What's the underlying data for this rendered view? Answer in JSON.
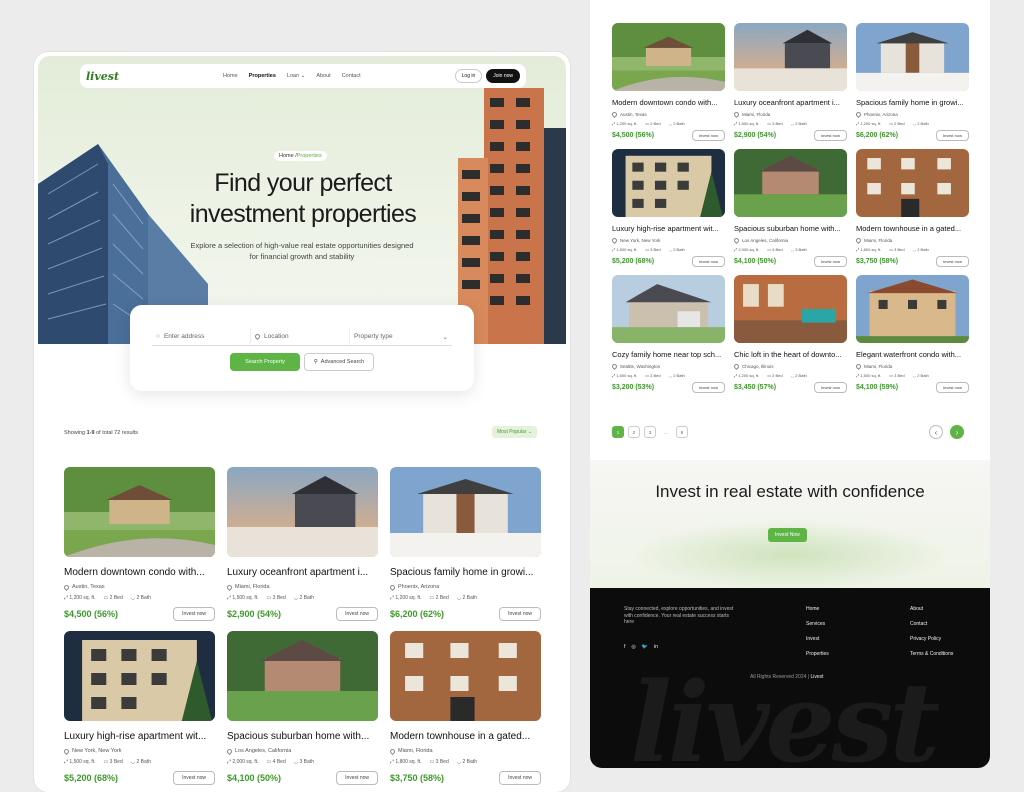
{
  "nav": {
    "logo": "livest",
    "links": [
      "Home",
      "Properties",
      "Loan",
      "About",
      "Contact"
    ],
    "active": "Properties",
    "login": "Log in",
    "join": "Join now"
  },
  "hero": {
    "breadcrumb_home": "Home /",
    "breadcrumb_current": "Properties",
    "title": "Find your perfect investment properties",
    "subtitle": "Explore a selection of high-value real estate opportunities designed for financial growth and stability"
  },
  "search": {
    "address_placeholder": "Enter address",
    "location_placeholder": "Location",
    "type_placeholder": "Property type",
    "search_btn": "Search Property",
    "advanced_btn": "Advanced Search"
  },
  "results": {
    "showing_prefix": "Showing ",
    "showing_range": "1-9",
    "showing_suffix": " of total 72 results",
    "sort": "Most Popular"
  },
  "invest_label": "Invest now",
  "properties": [
    {
      "title": "Modern downtown condo with...",
      "loc": "Austin, Texas",
      "sqft": "1,200 sq. ft.",
      "bed": "2 Bed",
      "bath": "2 Bath",
      "price": "$4,500 (56%)",
      "scene": "house1"
    },
    {
      "title": "Luxury oceanfront apartment i...",
      "loc": "Miami, Florida",
      "sqft": "1,500 sq. ft.",
      "bed": "3 Bed",
      "bath": "2 Bath",
      "price": "$2,900 (54%)",
      "scene": "sunset"
    },
    {
      "title": "Spacious family home in growi...",
      "loc": "Phoenix, Arizona",
      "sqft": "1,200 sq. ft.",
      "bed": "2 Bed",
      "bath": "2 Bath",
      "price": "$6,200 (62%)",
      "scene": "modern"
    },
    {
      "title": "Luxury high-rise apartment wit...",
      "loc": "New York, New York",
      "sqft": "1,500 sq. ft.",
      "bed": "3 Bed",
      "bath": "2 Bath",
      "price": "$5,200 (68%)",
      "scene": "tall"
    },
    {
      "title": "Spacious suburban home with...",
      "loc": "Los Angeles, California",
      "sqft": "2,000 sq. ft.",
      "bed": "4 Bed",
      "bath": "3 Bath",
      "price": "$4,100 (50%)",
      "scene": "suburb"
    },
    {
      "title": "Modern townhouse in a gated...",
      "loc": "Miami, Florida",
      "sqft": "1,800 sq. ft.",
      "bed": "3 Bed",
      "bath": "2 Bath",
      "price": "$3,750 (58%)",
      "scene": "brick"
    },
    {
      "title": "Cozy family home near top sch...",
      "loc": "Seattle, Washington",
      "sqft": "1,500 sq. ft.",
      "bed": "3 Bed",
      "bath": "2 Bath",
      "price": "$3,200 (53%)",
      "scene": "cottage"
    },
    {
      "title": "Chic loft in the heart of downto...",
      "loc": "Chicago, Illinois",
      "sqft": "1,200 sq. ft.",
      "bed": "2 Bed",
      "bath": "2 Bath",
      "price": "$3,450 (57%)",
      "scene": "loft"
    },
    {
      "title": "Elegant waterfront condo with...",
      "loc": "Miami, Florida",
      "sqft": "1,500 sq. ft.",
      "bed": "3 Bed",
      "bath": "2 Bath",
      "price": "$4,100 (59%)",
      "scene": "villa"
    }
  ],
  "pager": {
    "pages": [
      "1",
      "2",
      "3",
      "...",
      "9"
    ],
    "active": "1"
  },
  "cta": {
    "title": "Invest in real estate with confidence",
    "button": "Invest Now"
  },
  "footer": {
    "desc": "Stay connected, explore opportunities, and invest with confidence. Your real estate success starts here",
    "col1": [
      "Home",
      "Services",
      "Invest",
      "Properties"
    ],
    "col2": [
      "About",
      "Contact",
      "Privacy Policy",
      "Terms & Conditions"
    ],
    "copy": "All Rights Reserved 2024 |",
    "brand": "Livest",
    "social": [
      "f-icon",
      "instagram-icon",
      "twitter-icon",
      "linkedin-icon"
    ]
  },
  "colors": {
    "accent": "#5eb444",
    "price": "#3d9a2a",
    "dark": "#0c0c0c"
  }
}
